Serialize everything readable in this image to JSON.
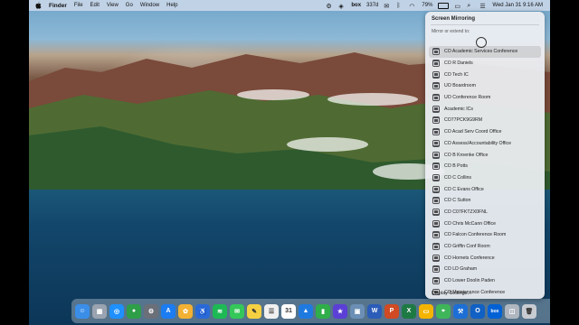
{
  "menubar": {
    "app_name": "Finder",
    "menus": [
      "File",
      "Edit",
      "View",
      "Go",
      "Window",
      "Help"
    ],
    "status": {
      "box_label": "box",
      "temperature": "337d",
      "battery_percent": "79%",
      "datetime": "Wed Jan 31  9:16 AM"
    }
  },
  "screen_mirroring": {
    "title": "Screen Mirroring",
    "subtitle": "Mirror or extend to:",
    "devices": [
      "CO Academic Services Conference",
      "CO R Daniels",
      "CO Tech IC",
      "UO Boardroom",
      "UO Conference Room",
      "Academic ICs",
      "CO77PCK9G9RM",
      "CO Acad Serv Coord Office",
      "CO Assess/Accountability Office",
      "CO B Kroenke Office",
      "CO B Potts",
      "CO C Collins",
      "CO C Evans Office",
      "CO C Sutton",
      "CO C07FKTZX0FNL",
      "CO Chris McCann Office",
      "CO Falcon Conference Room",
      "CO Griffin Conf Room",
      "CO Hornets Conference",
      "CO LD Graham",
      "CO Lower Doolin Paden",
      "CO Maintenance Conference"
    ],
    "selected_index": 0,
    "footer": "Display Settings..."
  },
  "dock": {
    "apps": [
      {
        "name": "finder",
        "color": "#3a8ee8",
        "glyph": "☺"
      },
      {
        "name": "launchpad",
        "color": "#9aa3b0",
        "glyph": "▦"
      },
      {
        "name": "safari",
        "color": "#1e90ff",
        "glyph": "◎"
      },
      {
        "name": "chrome",
        "color": "#2e9e48",
        "glyph": "●"
      },
      {
        "name": "system-preferences",
        "color": "#6b6f78",
        "glyph": "⚙"
      },
      {
        "name": "app-store",
        "color": "#1c7cf2",
        "glyph": "A"
      },
      {
        "name": "photos",
        "color": "#f2b133",
        "glyph": "✿"
      },
      {
        "name": "accessibility",
        "color": "#2a6ad8",
        "glyph": "♿"
      },
      {
        "name": "spotify",
        "color": "#1db954",
        "glyph": "≋"
      },
      {
        "name": "messages",
        "color": "#34c759",
        "glyph": "✉"
      },
      {
        "name": "notes",
        "color": "#f5d142",
        "glyph": "✎"
      },
      {
        "name": "reminders",
        "color": "#f0f0f0",
        "glyph": "☰"
      },
      {
        "name": "calendar",
        "color": "#ffffff",
        "glyph": "31"
      },
      {
        "name": "keynote",
        "color": "#1f7ae0",
        "glyph": "▲"
      },
      {
        "name": "numbers",
        "color": "#2fae4a",
        "glyph": "▮"
      },
      {
        "name": "imovie",
        "color": "#5b3fd6",
        "glyph": "★"
      },
      {
        "name": "preview",
        "color": "#6b8fb5",
        "glyph": "▣"
      },
      {
        "name": "word",
        "color": "#2b5cb8",
        "glyph": "W"
      },
      {
        "name": "powerpoint",
        "color": "#d04a23",
        "glyph": "P"
      },
      {
        "name": "excel",
        "color": "#1e7a44",
        "glyph": "X"
      },
      {
        "name": "google-slides",
        "color": "#f4b400",
        "glyph": "▭"
      },
      {
        "name": "maps",
        "color": "#3fb55a",
        "glyph": "⌖"
      },
      {
        "name": "xcode",
        "color": "#1d6fd6",
        "glyph": "⚒"
      },
      {
        "name": "outlook",
        "color": "#1160c4",
        "glyph": "O"
      },
      {
        "name": "box",
        "color": "#0061d5",
        "glyph": "box"
      },
      {
        "name": "screenshot",
        "color": "#b0b6bf",
        "glyph": "◫"
      },
      {
        "name": "trash",
        "color": "#c8ccd2",
        "glyph": "🗑"
      }
    ]
  }
}
